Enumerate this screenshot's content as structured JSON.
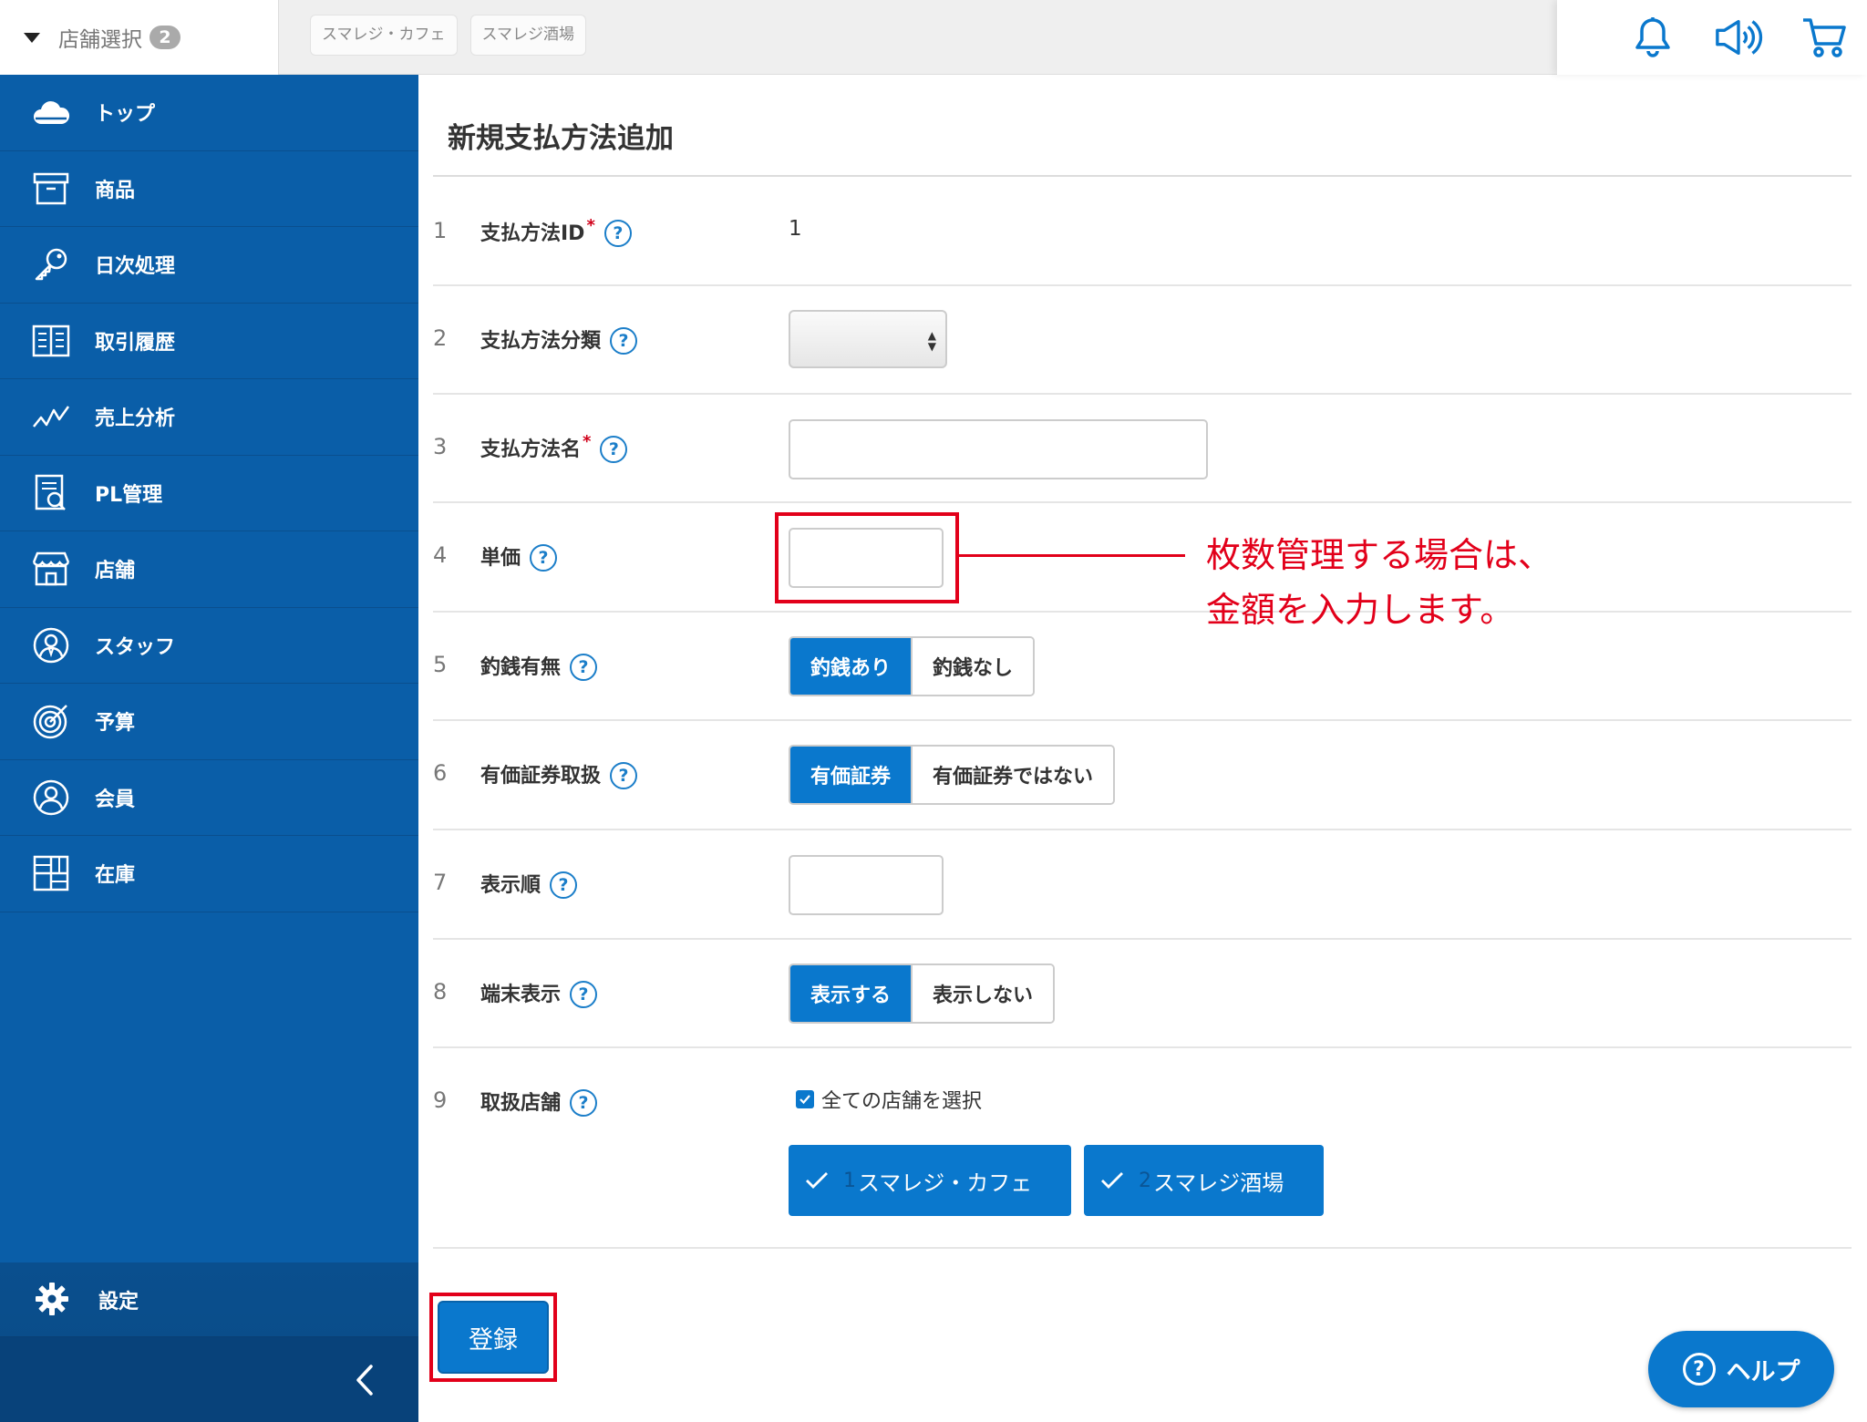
{
  "topbar": {
    "store_select_label": "店舗選択",
    "store_count": "2",
    "store_chips": [
      "スマレジ・カフェ",
      "スマレジ酒場"
    ],
    "icons": [
      "bell-icon",
      "megaphone-icon",
      "cart-icon"
    ]
  },
  "sidebar": {
    "items": [
      {
        "label": "トップ",
        "icon": "cloud-icon"
      },
      {
        "label": "商品",
        "icon": "box-icon"
      },
      {
        "label": "日次処理",
        "icon": "key-icon"
      },
      {
        "label": "取引履歴",
        "icon": "ledger-icon"
      },
      {
        "label": "売上分析",
        "icon": "chart-line-icon"
      },
      {
        "label": "PL管理",
        "icon": "report-icon"
      },
      {
        "label": "店舗",
        "icon": "store-icon"
      },
      {
        "label": "スタッフ",
        "icon": "staff-icon"
      },
      {
        "label": "予算",
        "icon": "target-icon"
      },
      {
        "label": "会員",
        "icon": "member-icon"
      },
      {
        "label": "在庫",
        "icon": "inventory-icon"
      }
    ],
    "settings_label": "設定"
  },
  "form": {
    "title": "新規支払方法追加",
    "rows": [
      {
        "num": "1",
        "label": "支払方法ID",
        "required": "*",
        "value": "1"
      },
      {
        "num": "2",
        "label": "支払方法分類"
      },
      {
        "num": "3",
        "label": "支払方法名",
        "required": "*"
      },
      {
        "num": "4",
        "label": "単価"
      },
      {
        "num": "5",
        "label": "釣銭有無",
        "options": [
          "釣銭あり",
          "釣銭なし"
        ]
      },
      {
        "num": "6",
        "label": "有価証券取扱",
        "options": [
          "有価証券",
          "有価証券ではない"
        ]
      },
      {
        "num": "7",
        "label": "表示順"
      },
      {
        "num": "8",
        "label": "端末表示",
        "options": [
          "表示する",
          "表示しない"
        ]
      },
      {
        "num": "9",
        "label": "取扱店舗",
        "select_all": "全ての店舗を選択",
        "stores": [
          {
            "id": "1",
            "name": "スマレジ・カフェ"
          },
          {
            "id": "2",
            "name": "スマレジ酒場"
          }
        ]
      }
    ],
    "help_glyph": "?",
    "submit_label": "登録"
  },
  "annotation": {
    "line1": "枚数管理する場合は、",
    "line2": "金額を入力します。"
  },
  "help_button": {
    "glyph": "?",
    "label": "ヘルプ"
  },
  "colors": {
    "sidebar": "#0a5ea8",
    "accent": "#0a78cd",
    "annotation": "#e2001a"
  }
}
